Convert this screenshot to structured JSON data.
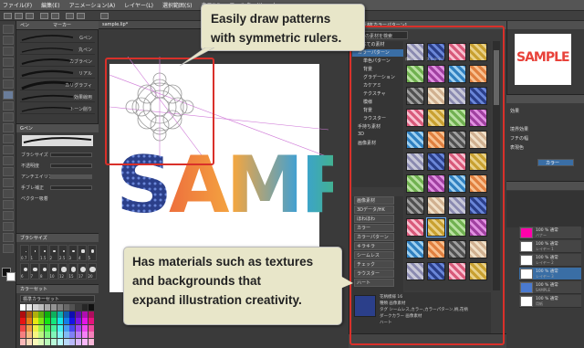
{
  "menu": [
    "ファイル(F)",
    "編集(E)",
    "アニメーション(A)",
    "レイヤー(L)",
    "選択範囲(S)",
    "表示(V)",
    "フィルター(I)",
    "ウィ"
  ],
  "canvas_tab": "sample.lip*",
  "subtool": {
    "tabs": [
      "ペン",
      "マーカー"
    ],
    "strokes": [
      "Gペン",
      "丸ペン",
      "カブラペン",
      "リアル",
      "カリグラフィ",
      "効果線用",
      "トーン削り"
    ]
  },
  "tool_property": {
    "title": "Gペン",
    "rows": [
      "ブラシサイズ",
      "不透明度",
      "アンチエイリアス",
      "手ブレ補正",
      "ベクター吸着"
    ]
  },
  "brush_size": {
    "title": "ブラシサイズ",
    "values": [
      "0.7",
      "1",
      "1.5",
      "2",
      "2.5",
      "3",
      "4",
      "5",
      "6",
      "7",
      "8",
      "10",
      "12",
      "15",
      "17",
      "20"
    ]
  },
  "color_panel": {
    "title": "カラーセット",
    "set": "標準カラーセット"
  },
  "sample_text": "SAMPLE",
  "material": {
    "title": "素材[カラーパターン]",
    "header": "全ての素材を検索",
    "tree": [
      "すべての素材",
      "カラーパターン",
      "単色パターン",
      "背景",
      "グラデーション",
      "カケアミ",
      "テクスチャ",
      "模様",
      "背景",
      "ラウスター",
      "手持ち素材",
      "3D",
      "画像素材"
    ],
    "tags": [
      "画像素材",
      "3Dデータ/HK",
      "ほわほわ",
      "カラー",
      "カラーパターン",
      "キラキラ",
      "シームレス",
      "チェック",
      "ラウスター",
      "ハート"
    ],
    "thumbs": [
      "花柄",
      "ストライプ",
      "",
      "",
      "",
      "",
      "",
      "",
      "",
      "",
      "",
      "",
      "",
      "",
      "",
      "",
      "",
      "",
      "",
      "",
      "",
      "",
      "",
      "",
      "",
      "",
      "",
      "",
      "",
      "",
      "",
      "",
      "",
      "",
      "",
      "",
      "",
      "",
      "",
      "",
      ""
    ],
    "info": [
      "花柄模様 16",
      "種類 画像素材",
      "タグ シームレス,カラー,カラーパターン,柄,花柄",
      "ダークカラー 画像素材",
      "ハート"
    ]
  },
  "navigator": {
    "preview_text": "SAMPLE"
  },
  "layer_property": {
    "title": "効果",
    "rows": [
      "境界効果",
      "フチの幅",
      "カラー",
      "表現色"
    ]
  },
  "layers": [
    {
      "name": "100 % 通常",
      "sub": "バナー"
    },
    {
      "name": "100 % 通常",
      "sub": "レイヤー 1"
    },
    {
      "name": "100 % 通常",
      "sub": "レイヤー 2"
    },
    {
      "name": "100 % 通常",
      "sub": "レイヤー 3"
    },
    {
      "name": "100 % 通常",
      "sub": "SAMPLE"
    },
    {
      "name": "100 % 通常",
      "sub": "用紙"
    }
  ],
  "callouts": {
    "top": [
      "Easily draw patterns",
      "with symmetric rulers."
    ],
    "bottom": [
      "Has materials such as textures",
      "and backgrounds that",
      "expand illustration creativity."
    ]
  },
  "colors": {
    "highlight": "#d9302a",
    "callout_bg": "#e8e6c9"
  }
}
